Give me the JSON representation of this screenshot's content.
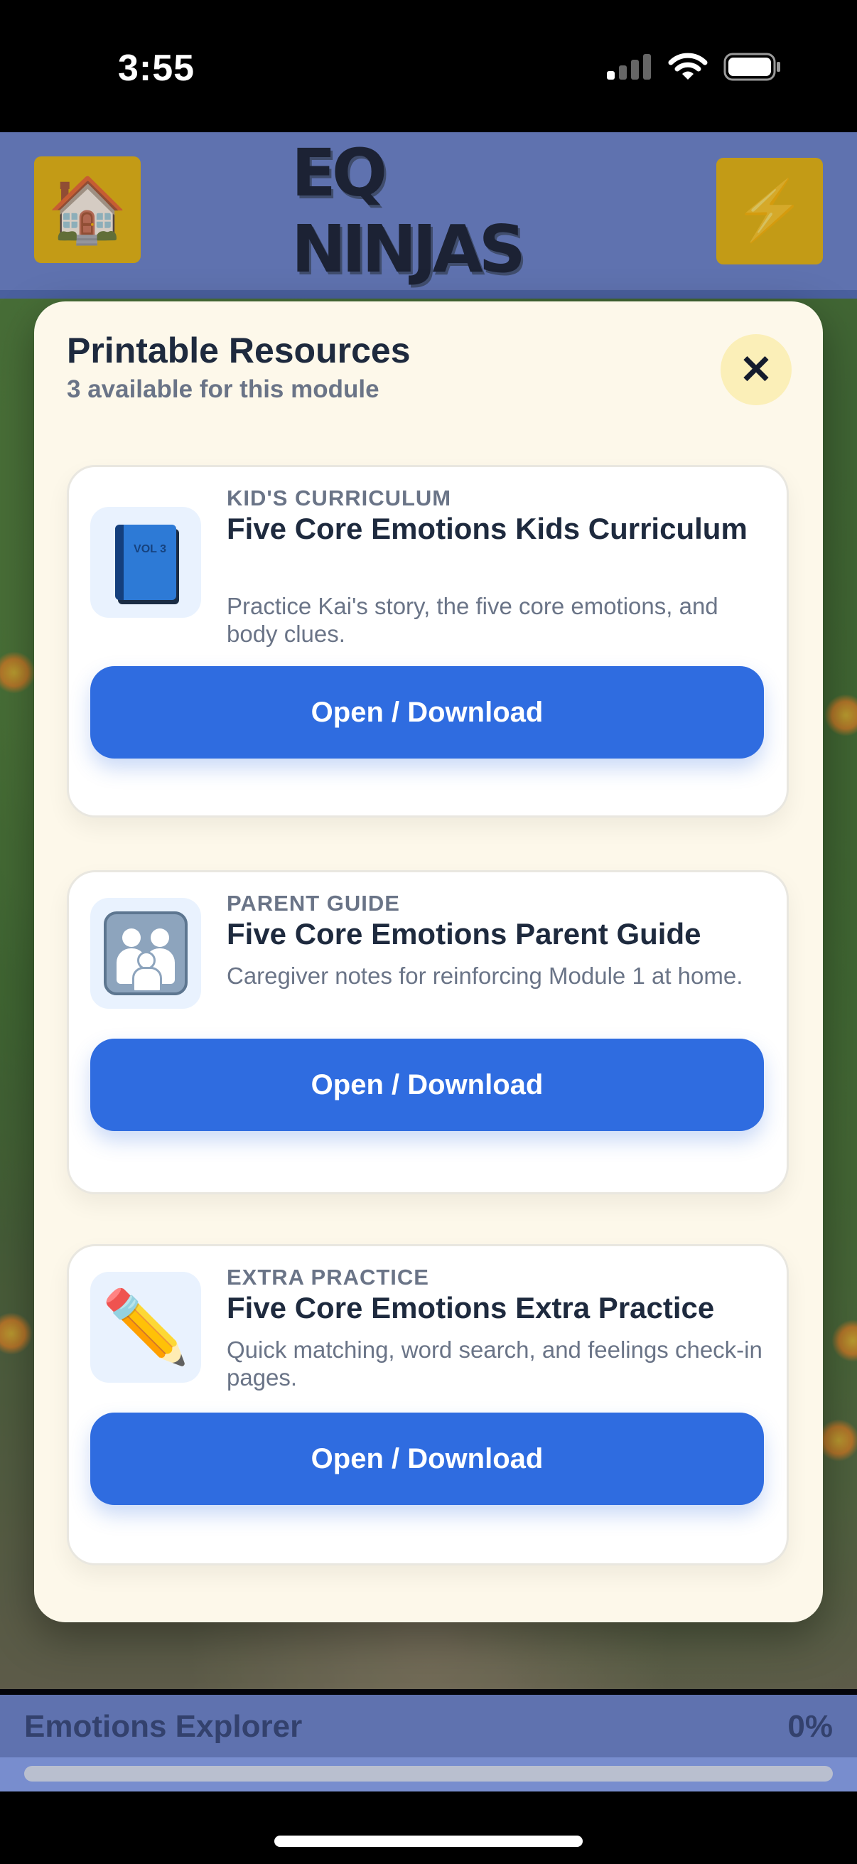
{
  "status_bar": {
    "time": "3:55"
  },
  "header": {
    "logo_text": "EQ NINJAS",
    "home_icon": "house-icon",
    "bolt_icon": "lightning-bolt-icon"
  },
  "modal": {
    "title": "Printable Resources",
    "subtitle": "3 available for this module",
    "close_label": "✕",
    "resources": [
      {
        "category": "KID'S CURRICULUM",
        "title": "Five Core Emotions Kids Curriculum",
        "description": "Practice Kai's story, the five core emotions, and body clues.",
        "button_label": "Open / Download",
        "icon": "book-icon",
        "icon_text": "VOL 3"
      },
      {
        "category": "PARENT GUIDE",
        "title": "Five Core Emotions Parent Guide",
        "description": "Caregiver notes for reinforcing Module 1 at home.",
        "button_label": "Open / Download",
        "icon": "family-icon"
      },
      {
        "category": "EXTRA PRACTICE",
        "title": "Five Core Emotions Extra Practice",
        "description": "Quick matching, word search, and feelings check-in pages.",
        "button_label": "Open / Download",
        "icon": "pencil-icon"
      }
    ]
  },
  "progress": {
    "title": "Emotions Explorer",
    "percent_label": "0%",
    "value": 0
  },
  "colors": {
    "header": "#6f86c8",
    "accent_yellow": "#e9b80e",
    "button_blue": "#2f6ce0",
    "modal_bg": "#fdf8ea"
  }
}
